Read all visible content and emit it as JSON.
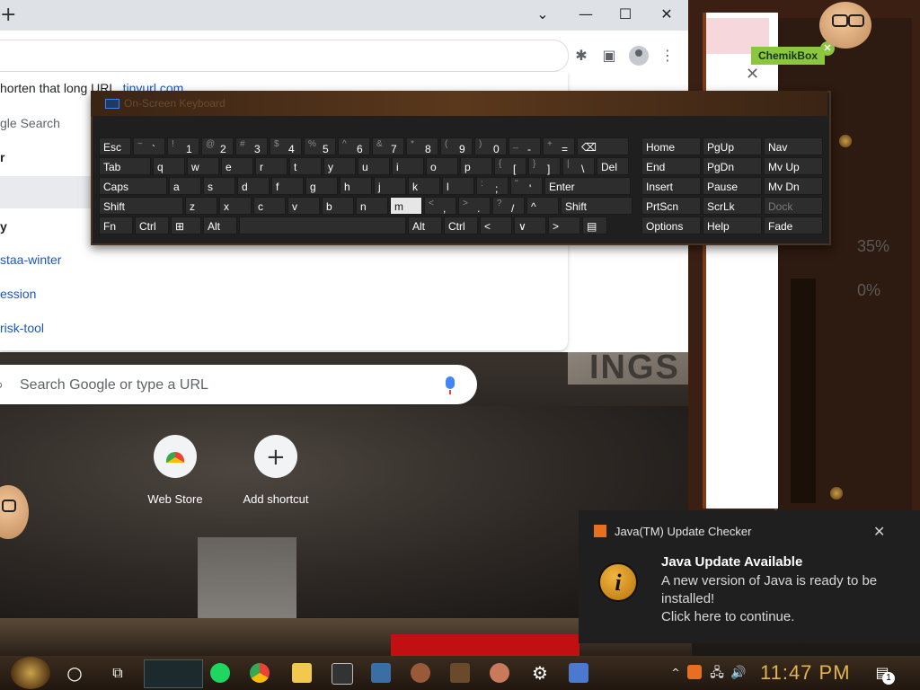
{
  "desktop": {
    "poster_text": "INGS",
    "widget_label": "ChemikBox",
    "widget_close": "✕",
    "popup_close": "✕",
    "percent_top": "35%",
    "percent_bottom": "0%"
  },
  "chrome": {
    "new_tab": "+",
    "window_controls": {
      "minimize": "—",
      "maximize": "☐",
      "close": "✕",
      "tab_dropdown": "⌄"
    },
    "toolbar": {
      "extensions_icon": "✱",
      "sidepanel_icon": "▣",
      "menu_icon": "⋮"
    },
    "suggestions": [
      {
        "text": "horten that long URL",
        "link": "tinyurl.com"
      },
      {
        "text": "gle Search"
      },
      {
        "text": "r"
      },
      {
        "text": "y"
      },
      {
        "text": "staa-winter"
      },
      {
        "text": "ession"
      },
      {
        "text": "risk-tool"
      }
    ],
    "search_placeholder": "Search Google or type a URL",
    "shortcuts": [
      {
        "label": "Web Store"
      },
      {
        "label": "Add shortcut"
      }
    ]
  },
  "keyboard": {
    "title": "On-Screen Keyboard",
    "rows": [
      [
        {
          "label": "Esc"
        },
        {
          "sub": "~",
          "main": "`"
        },
        {
          "sub": "!",
          "main": "1"
        },
        {
          "sub": "@",
          "main": "2"
        },
        {
          "sub": "#",
          "main": "3"
        },
        {
          "sub": "$",
          "main": "4"
        },
        {
          "sub": "%",
          "main": "5"
        },
        {
          "sub": "^",
          "main": "6"
        },
        {
          "sub": "&",
          "main": "7"
        },
        {
          "sub": "*",
          "main": "8"
        },
        {
          "sub": "(",
          "main": "9"
        },
        {
          "sub": ")",
          "main": "0"
        },
        {
          "sub": "_",
          "main": "-"
        },
        {
          "sub": "+",
          "main": "="
        },
        {
          "label": "⌫"
        }
      ],
      [
        {
          "label": "Tab"
        },
        {
          "label": "q"
        },
        {
          "label": "w"
        },
        {
          "label": "e"
        },
        {
          "label": "r"
        },
        {
          "label": "t"
        },
        {
          "label": "y"
        },
        {
          "label": "u"
        },
        {
          "label": "i"
        },
        {
          "label": "o"
        },
        {
          "label": "p"
        },
        {
          "sub": "{",
          "main": "["
        },
        {
          "sub": "}",
          "main": "]"
        },
        {
          "sub": "|",
          "main": "\\"
        },
        {
          "label": "Del"
        }
      ],
      [
        {
          "label": "Caps"
        },
        {
          "label": "a"
        },
        {
          "label": "s"
        },
        {
          "label": "d"
        },
        {
          "label": "f"
        },
        {
          "label": "g"
        },
        {
          "label": "h"
        },
        {
          "label": "j"
        },
        {
          "label": "k"
        },
        {
          "label": "l"
        },
        {
          "sub": ":",
          "main": ";"
        },
        {
          "sub": "\"",
          "main": "'"
        },
        {
          "label": "Enter"
        }
      ],
      [
        {
          "label": "Shift"
        },
        {
          "label": "z"
        },
        {
          "label": "x"
        },
        {
          "label": "c"
        },
        {
          "label": "v"
        },
        {
          "label": "b"
        },
        {
          "label": "n"
        },
        {
          "label": "m"
        },
        {
          "sub": "<",
          "main": ","
        },
        {
          "sub": ">",
          "main": "."
        },
        {
          "sub": "?",
          "main": "/"
        },
        {
          "label": "^"
        },
        {
          "label": "Shift"
        }
      ],
      [
        {
          "label": "Fn"
        },
        {
          "label": "Ctrl"
        },
        {
          "label": "⊞"
        },
        {
          "label": "Alt"
        },
        {
          "label": ""
        },
        {
          "label": "Alt"
        },
        {
          "label": "Ctrl"
        },
        {
          "label": "<"
        },
        {
          "label": "∨"
        },
        {
          "label": ">"
        },
        {
          "label": "▤"
        }
      ]
    ],
    "nav_rows": [
      [
        "Home",
        "PgUp",
        "Nav"
      ],
      [
        "End",
        "PgDn",
        "Mv Up"
      ],
      [
        "Insert",
        "Pause",
        "Mv Dn"
      ],
      [
        "PrtScn",
        "ScrLk",
        "Dock"
      ],
      [
        "Options",
        "Help",
        "Fade"
      ]
    ]
  },
  "toast": {
    "app_name": "Java(TM) Update Checker",
    "close": "✕",
    "icon_glyph": "i",
    "heading": "Java Update Available",
    "body_lines": [
      "A new version of Java is ready to be",
      "installed!",
      "Click here to continue."
    ]
  },
  "taskbar": {
    "time": "11:47 PM",
    "notification_count": "1",
    "cortana_icon": "○",
    "taskview_icon": "⧉",
    "settings_icon": "⚙",
    "volume_icon": "🔊",
    "network_icon": "🖧",
    "chevron_icon": "^"
  }
}
